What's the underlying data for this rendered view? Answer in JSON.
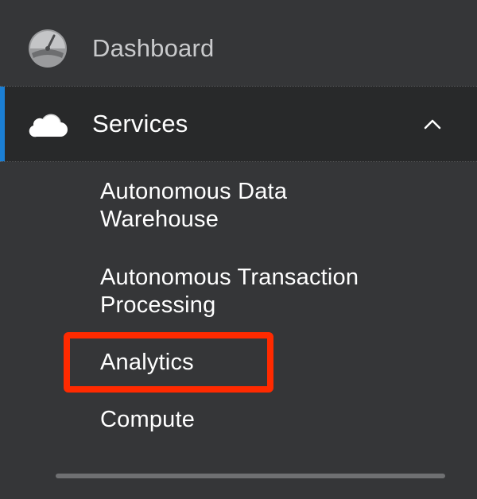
{
  "nav": {
    "dashboard": {
      "label": "Dashboard",
      "icon": "dashboard-gauge-icon"
    },
    "services": {
      "label": "Services",
      "icon": "cloud-icon",
      "expanded": true,
      "chevron_icon": "chevron-up-icon",
      "sub_items": [
        {
          "line1": "Autonomous Data",
          "line2": "Warehouse"
        },
        {
          "line1": "Autonomous Transaction",
          "line2": "Processing"
        },
        {
          "line1": "Analytics"
        },
        {
          "line1": "Compute"
        }
      ]
    }
  },
  "colors": {
    "background": "#353638",
    "active_row": "#28292a",
    "active_accent": "#1b7fd4",
    "highlight": "#ff2a00"
  }
}
